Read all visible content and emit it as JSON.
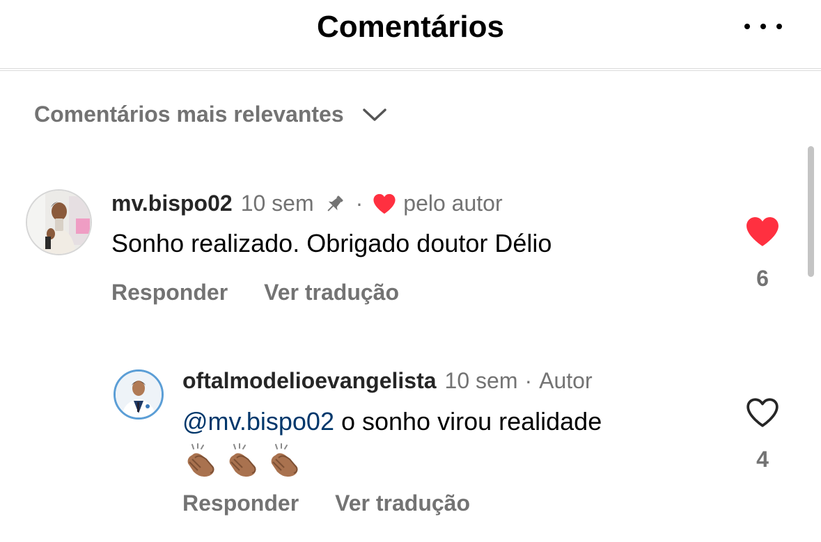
{
  "header": {
    "title": "Comentários",
    "more_icon": "more-horizontal-icon"
  },
  "sort": {
    "label": "Comentários mais relevantes",
    "icon": "chevron-down-icon"
  },
  "comments": [
    {
      "username": "mv.bispo02",
      "time": "10 sem",
      "pinned": true,
      "separator": "·",
      "liked_by_author_label": "pelo autor",
      "text": "Sonho realizado. Obrigado doutor Délio",
      "reply_label": "Responder",
      "translate_label": "Ver tradução",
      "like_count": "6",
      "liked": true
    },
    {
      "username": "oftalmodelioevangelista",
      "time": "10 sem",
      "separator": "·",
      "author_badge": "Autor",
      "mention": "@mv.bispo02",
      "text": " o sonho virou realidade",
      "emoji": "👏🏽👏🏽👏🏽",
      "reply_label": "Responder",
      "translate_label": "Ver tradução",
      "like_count": "4",
      "liked": false
    }
  ],
  "colors": {
    "like_red": "#ff3040",
    "muted_text": "#737373",
    "mention_blue": "#00376b"
  }
}
